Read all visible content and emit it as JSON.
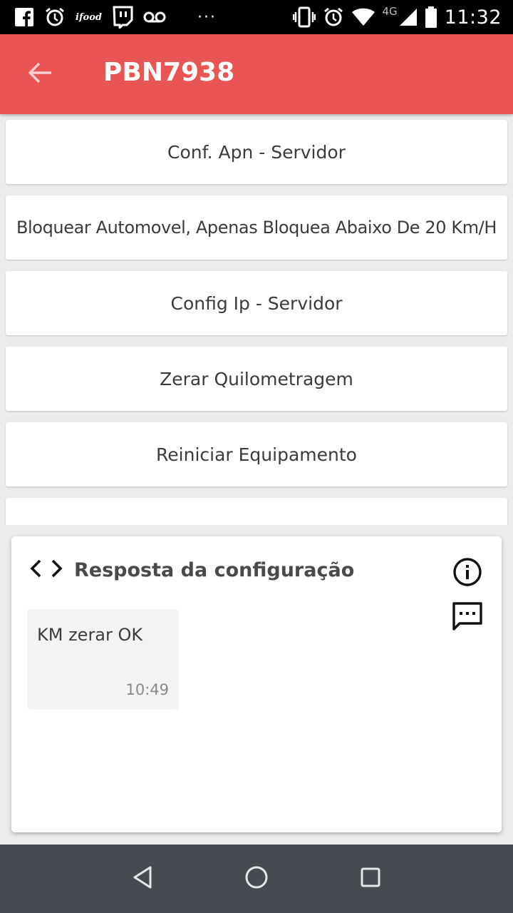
{
  "status_bar": {
    "time": "11:32",
    "network_type": "4G",
    "ifood_label": "ifood",
    "icons": [
      "facebook-icon",
      "alarm-icon",
      "ifood-icon",
      "twitch-icon",
      "voicemail-icon",
      "more-dots-icon",
      "vibrate-icon",
      "alarm-icon",
      "wifi-icon",
      "signal-icon",
      "battery-icon"
    ]
  },
  "app_bar": {
    "title": "PBN7938",
    "color": "#e95553",
    "back_icon": "arrow-back-icon"
  },
  "commands": [
    {
      "label": "Conf. Apn - Servidor"
    },
    {
      "label": "Bloquear Automovel, Apenas Bloquea Abaixo De 20 Km/H"
    },
    {
      "label": "Config Ip - Servidor"
    },
    {
      "label": "Zerar Quilometragem"
    },
    {
      "label": "Reiniciar Equipamento"
    }
  ],
  "response_panel": {
    "title": "Resposta da configuração",
    "icons": [
      "code-icon",
      "info-icon",
      "chat-icon"
    ],
    "message": {
      "text": "KM zerar OK",
      "time": "10:49"
    }
  },
  "nav_bar": {
    "icons": [
      "back-triangle-icon",
      "home-circle-icon",
      "recents-square-icon"
    ]
  }
}
